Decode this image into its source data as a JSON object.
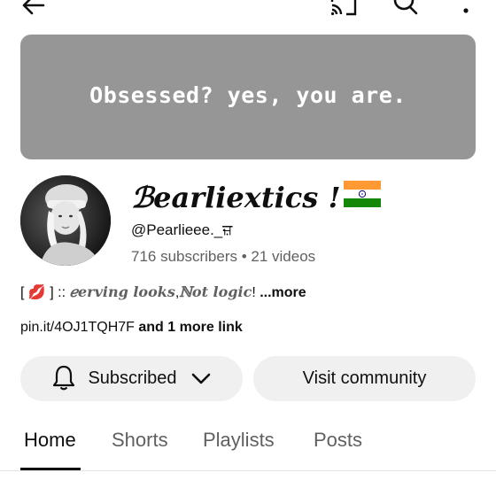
{
  "banner": {
    "text": "Obsessed? yes, you are."
  },
  "channel": {
    "name": "ℬearliextics !",
    "flag": "india-flag",
    "handle": "@Pearlieee._ਜ਼",
    "stats": "716 subscribers • 21 videos"
  },
  "description": {
    "open": "[ ",
    "emoji": "💋",
    "close": " ] :: ",
    "bold1": "ℯerving looks",
    "comma": ",",
    "bold2": "ℕot logic",
    "excl": "!",
    "more": " ...more"
  },
  "links": {
    "main": "pin.it/4OJ1TQH7F",
    "extra": " and 1 more link"
  },
  "buttons": {
    "subscribed": "Subscribed",
    "community": "Visit community"
  },
  "tabs": [
    "Home",
    "Shorts",
    "Playlists",
    "Posts"
  ],
  "icons": {
    "back": "arrow-left-icon",
    "cast": "cast-icon",
    "search": "search-icon",
    "more": "more-vertical-icon"
  }
}
